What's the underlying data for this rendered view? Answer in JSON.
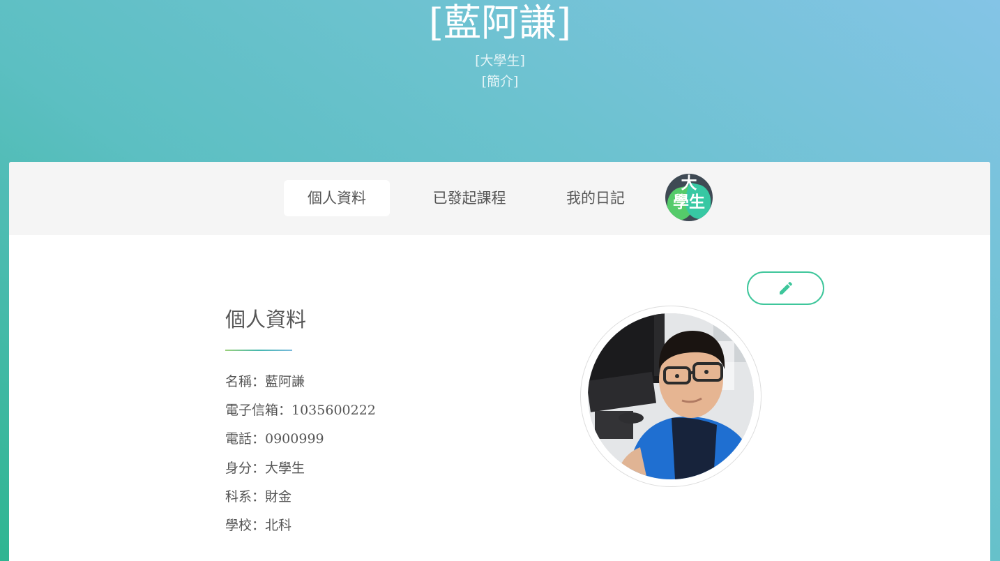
{
  "hero": {
    "name": "[藍阿謙]",
    "role": "[大學生]",
    "intro": "[簡介]"
  },
  "tabs": [
    {
      "label": "個人資料",
      "active": true
    },
    {
      "label": "已發起課程",
      "active": false
    },
    {
      "label": "我的日記",
      "active": false
    }
  ],
  "badge": {
    "line1": "大",
    "line2": "學生"
  },
  "profile": {
    "section_title": "個人資料",
    "rows": [
      "名稱：藍阿謙",
      "電子信箱：1035600222",
      "電話：0900999",
      "身分：大學生",
      "科系：財金",
      "學校：北科"
    ]
  },
  "edit_button": {
    "icon": "pencil-icon"
  },
  "colors": {
    "accent": "#3ec69b",
    "gradient_start": "#2fb591",
    "gradient_end": "#84c4e6",
    "tabbar_bg": "#f5f5f5"
  }
}
